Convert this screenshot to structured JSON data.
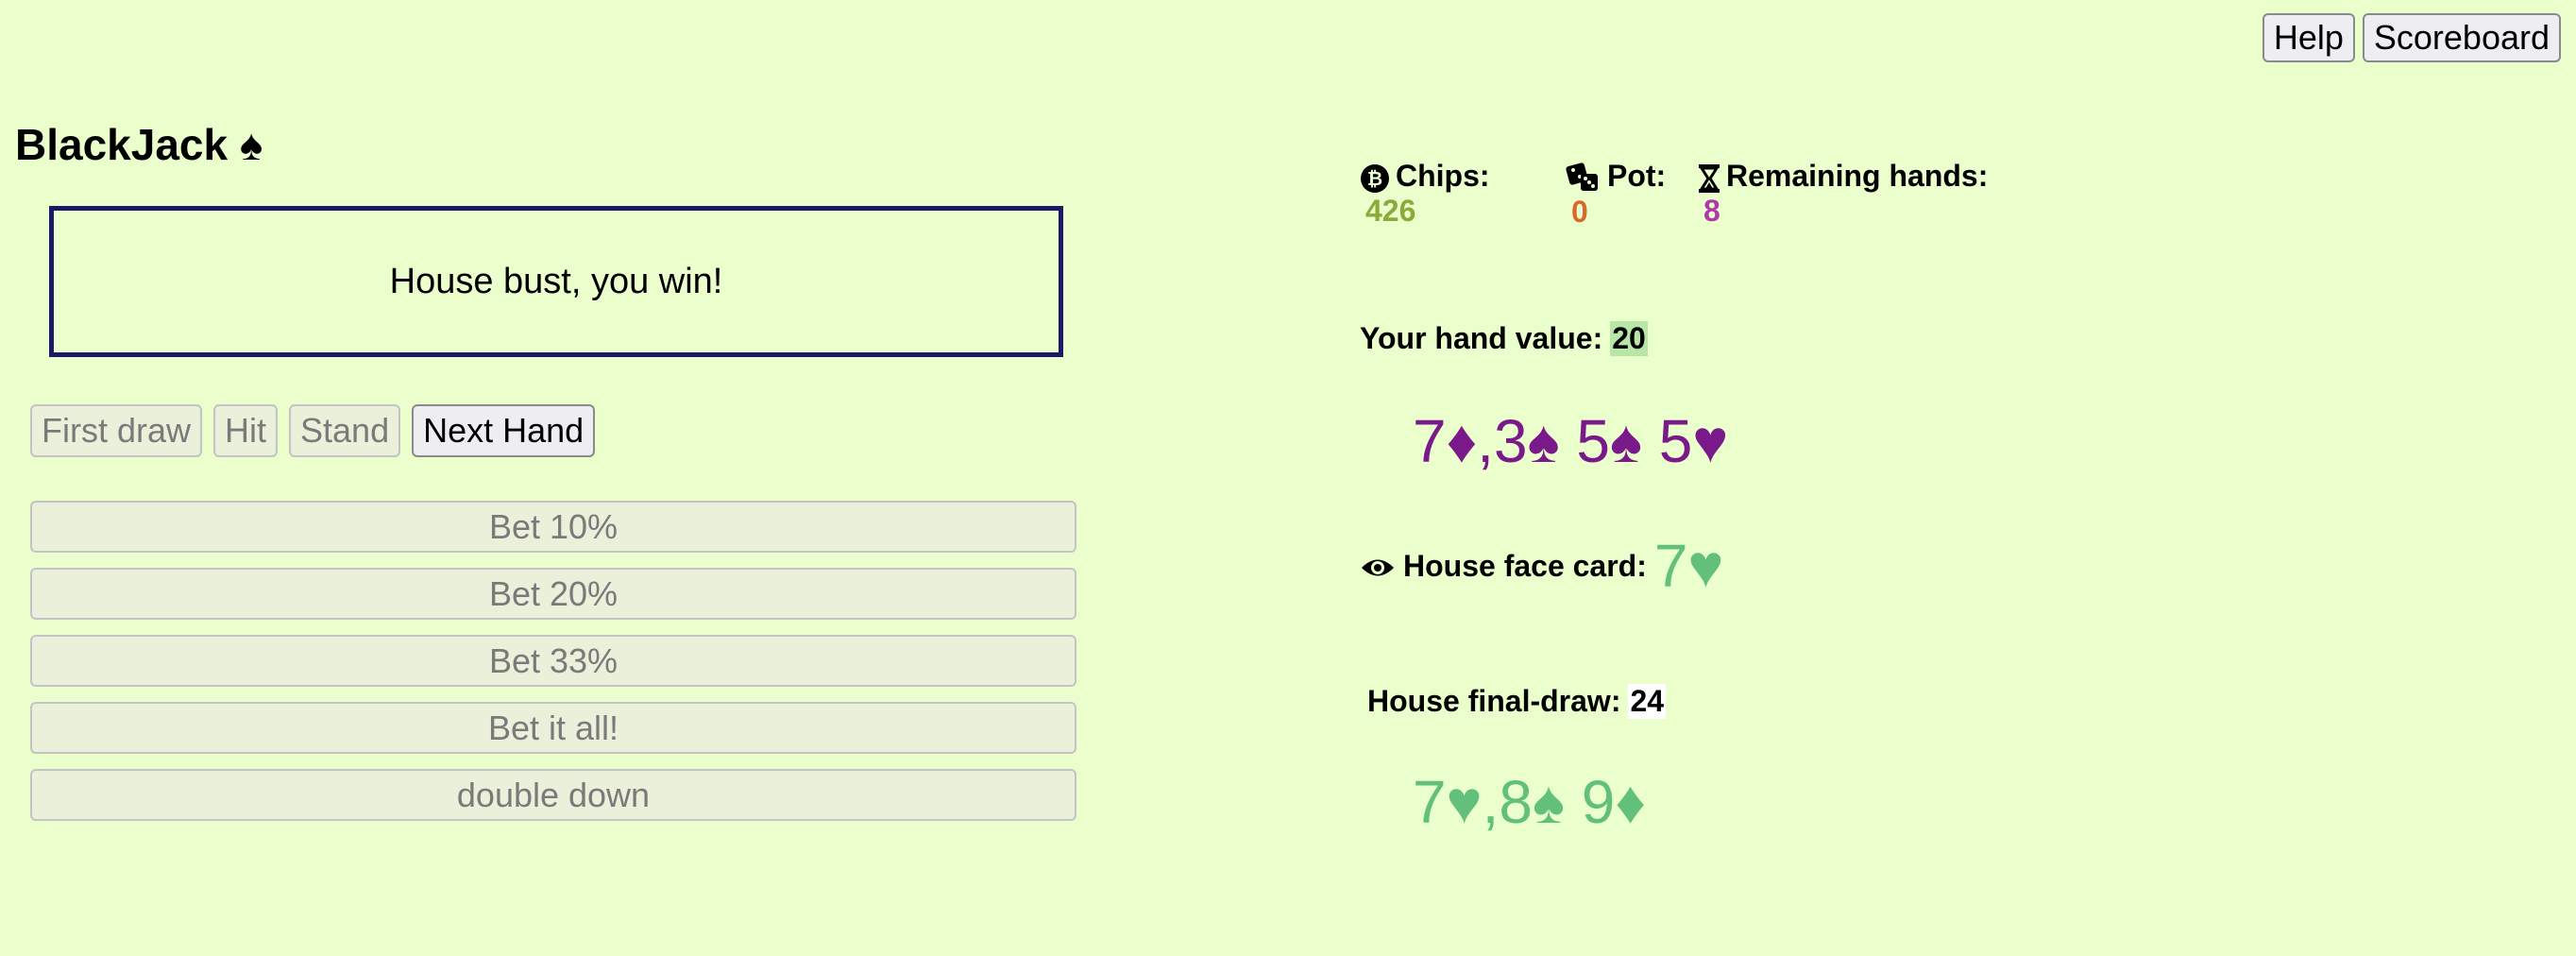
{
  "top_buttons": {
    "help": "Help",
    "scoreboard": "Scoreboard"
  },
  "title": "BlackJack ♠",
  "message": "House bust, you win!",
  "game_buttons": {
    "first_draw": "First draw",
    "hit": "Hit",
    "stand": "Stand",
    "next_hand": "Next Hand"
  },
  "bets": [
    "Bet 10%",
    "Bet 20%",
    "Bet 33%",
    "Bet it all!",
    "double down"
  ],
  "stats": {
    "chips_label": "Chips:",
    "chips_value": "426",
    "pot_label": "Pot:",
    "pot_value": "0",
    "remaining_label": "Remaining hands:",
    "remaining_value": "8"
  },
  "player": {
    "hand_value_label": "Your hand value:",
    "hand_value": "20",
    "cards": "7♦,3♠ 5♠ 5♥"
  },
  "house": {
    "face_card_label": "House face card:",
    "face_card": "7♥",
    "final_draw_label": "House final-draw:",
    "final_draw_value": "24",
    "cards": "7♥,8♠ 9♦"
  },
  "colors": {
    "background": "#eaffcc",
    "message_border": "#181a66",
    "chips_value": "#8aaa3a",
    "pot_value": "#d9682a",
    "remaining_value": "#b038a8",
    "player_cards": "#7a1a8a",
    "house_cards": "#63c07a",
    "hand_value_highlight": "#b8e6a6"
  },
  "icons": {
    "chips": "bitcoin-coin-icon",
    "pot": "dice-icon",
    "remaining": "hourglass-icon",
    "house_face": "eye-icon"
  }
}
